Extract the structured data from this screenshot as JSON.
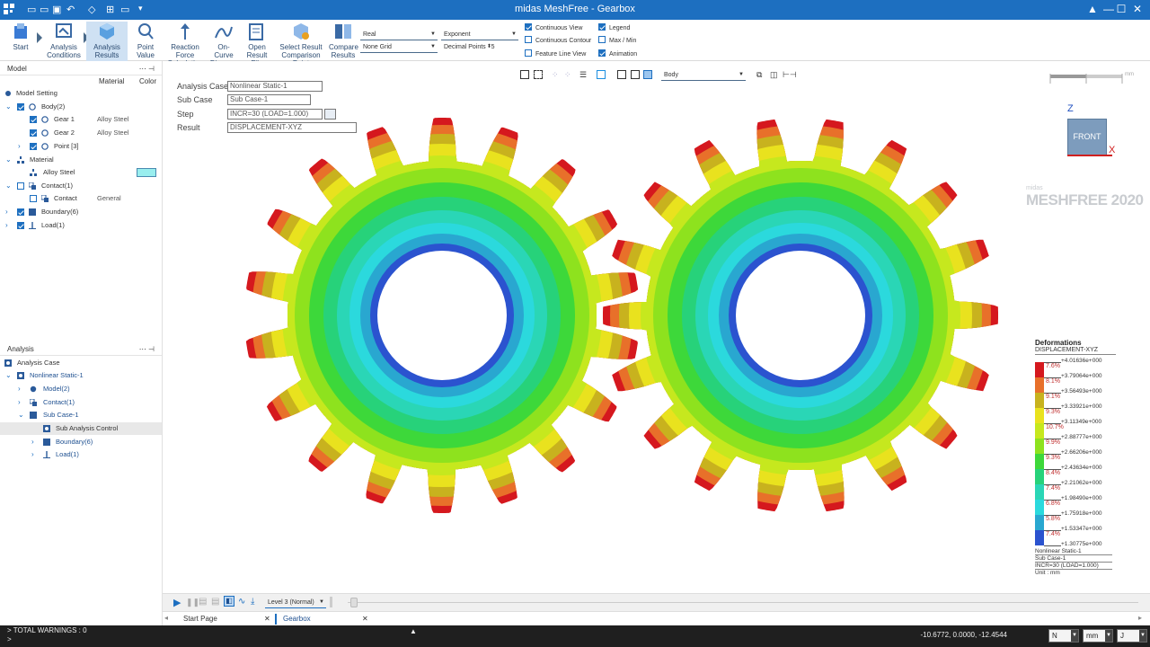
{
  "window": {
    "title": "midas MeshFree - Gearbox",
    "controls": [
      "▲",
      "—",
      "☐",
      "✕"
    ]
  },
  "ribbon": {
    "buttons": [
      {
        "id": "start",
        "label": "Start"
      },
      {
        "id": "analysis-conditions",
        "label": "Analysis\nConditions"
      },
      {
        "id": "analysis-results",
        "label": "Analysis\nResults"
      },
      {
        "id": "point-value",
        "label": "Point\nValue"
      },
      {
        "id": "reaction-force",
        "label": "Reaction Force\nCalculation"
      },
      {
        "id": "on-curve",
        "label": "On-Curve\nDiagram"
      },
      {
        "id": "open-result",
        "label": "Open\nResult File"
      },
      {
        "id": "select-result",
        "label": "Select Result\nComparison Point"
      },
      {
        "id": "compare-results",
        "label": "Compare\nResults"
      }
    ],
    "dropdowns": {
      "component": "Real",
      "grid": "None Grid",
      "format": "Exponent",
      "decimal_label": "Decimal Points",
      "decimal_value": "5"
    },
    "checks": [
      {
        "label": "Continuous View",
        "on": true
      },
      {
        "label": "Continuous Contour",
        "on": false
      },
      {
        "label": "Feature Line View",
        "on": false
      },
      {
        "label": "Legend",
        "on": true
      },
      {
        "label": "Max / Min",
        "on": false
      },
      {
        "label": "Animation",
        "on": true
      }
    ]
  },
  "model_panel": {
    "title": "Model",
    "col_material": "Material",
    "col_color": "Color",
    "rows": [
      {
        "label": "Model Setting",
        "mat": ""
      },
      {
        "label": "Body(2)",
        "mat": ""
      },
      {
        "label": "Gear 1",
        "mat": "Alloy Steel"
      },
      {
        "label": "Gear 2",
        "mat": "Alloy Steel"
      },
      {
        "label": "Point [3]",
        "mat": ""
      },
      {
        "label": "Material",
        "mat": ""
      },
      {
        "label": "Alloy Steel",
        "mat": ""
      },
      {
        "label": "Contact(1)",
        "mat": ""
      },
      {
        "label": "Contact",
        "mat": "General"
      },
      {
        "label": "Boundary(6)",
        "mat": ""
      },
      {
        "label": "Load(1)",
        "mat": ""
      }
    ],
    "material_color": "#99eeee"
  },
  "analysis_panel": {
    "title": "Analysis",
    "rows": [
      {
        "label": "Analysis Case"
      },
      {
        "label": "Nonlinear Static-1"
      },
      {
        "label": "Model(2)"
      },
      {
        "label": "Contact(1)"
      },
      {
        "label": "Sub Case-1"
      },
      {
        "label": "Sub Analysis Control"
      },
      {
        "label": "Boundary(6)"
      },
      {
        "label": "Load(1)"
      }
    ]
  },
  "viewport": {
    "info": {
      "analysis_case_label": "Analysis Case",
      "analysis_case_value": "Nonlinear Static-1",
      "sub_case_label": "Sub Case",
      "sub_case_value": "Sub Case-1",
      "step_label": "Step",
      "step_value": "INCR=30 (LOAD=1.000)",
      "result_label": "Result",
      "result_value": "DISPLACEMENT-XYZ"
    },
    "view_select": "Body",
    "axis": {
      "z": "Z",
      "x": "X",
      "face": "FRONT"
    },
    "scale_unit": "mm",
    "brand_small": "midas",
    "brand_big": "MESHFREE 2020"
  },
  "legend": {
    "title": "Deformations",
    "subtitle": "DISPLACEMENT-XYZ",
    "values": [
      "+4.01636e+000",
      "+3.79064e+000",
      "+3.56493e+000",
      "+3.33921e+000",
      "+3.11349e+000",
      "+2.88777e+000",
      "+2.66206e+000",
      "+2.43634e+000",
      "+2.21062e+000",
      "+1.98490e+000",
      "+1.75918e+000",
      "+1.53347e+000",
      "+1.30775e+000"
    ],
    "percents": [
      "7.6%",
      "8.1%",
      "9.1%",
      "9.3%",
      "10.7%",
      "9.9%",
      "9.3%",
      "8.4%",
      "7.4%",
      "6.8%",
      "5.8%",
      "7.4%"
    ],
    "colors": [
      "#d5181e",
      "#e8702a",
      "#c8b21e",
      "#e9e21e",
      "#c6e81e",
      "#8ee21e",
      "#3dd83a",
      "#27d27a",
      "#2ad6b6",
      "#2bd9dd",
      "#29a7d0",
      "#2b53cf"
    ],
    "footer": [
      "Nonlinear Static-1",
      "Sub Case-1",
      "INCR=30 (LOAD=1.000)",
      "Unit : mm"
    ]
  },
  "playback": {
    "level": "Level 3 (Normal)"
  },
  "tabs": [
    {
      "label": "Start Page",
      "close": "✕"
    },
    {
      "label": "Gearbox",
      "close": "✕"
    }
  ],
  "status": {
    "warnings": "> TOTAL WARNINGS : 0",
    "prompt": ">",
    "coords": "-10.6772, 0.0000, -12.4544",
    "unit_force": "N",
    "unit_length": "mm",
    "unit_energy": "J"
  }
}
